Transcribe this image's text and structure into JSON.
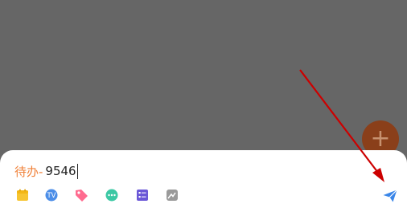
{
  "fab": {
    "icon": "plus-icon",
    "symbol": "+"
  },
  "quick_add": {
    "prefix": "待办-",
    "value": "9546"
  },
  "toolbar": {
    "tools": [
      {
        "name": "date-icon",
        "color": "#f7c531"
      },
      {
        "name": "tv-icon",
        "color": "#4c8ee8"
      },
      {
        "name": "tag-icon",
        "color": "#ff6b8f"
      },
      {
        "name": "more-icon",
        "color": "#3cc8a4"
      },
      {
        "name": "checklist-icon",
        "color": "#6a57d7"
      },
      {
        "name": "image-icon",
        "color": "#9a9a9a"
      }
    ],
    "send": {
      "name": "send-icon",
      "color": "#3a86e8"
    }
  },
  "annotation": {
    "color": "#cc0000"
  }
}
